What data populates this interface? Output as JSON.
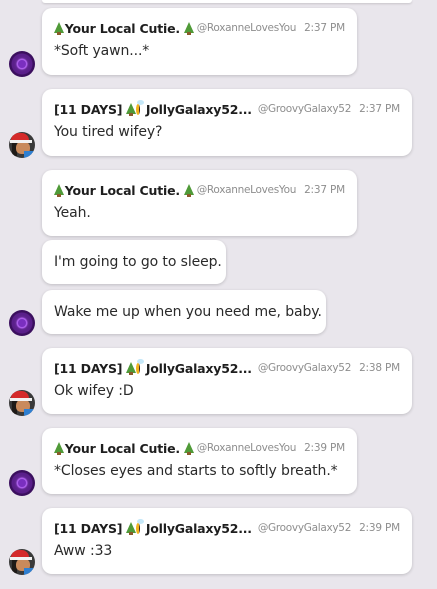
{
  "users": {
    "roxanne": {
      "name": "Your Local Cutie.",
      "handle": "@RoxanneLovesYou"
    },
    "jolly": {
      "prefix": "[11 DAYS]",
      "name": "JollyGalaxy52...",
      "handle": "@GroovyGalaxy52"
    }
  },
  "messages": [
    {
      "time": "2:37 PM",
      "text": "*Soft yawn...*"
    },
    {
      "time": "2:37 PM",
      "text": "You tired wifey?"
    },
    {
      "time": "2:37 PM",
      "text": "Yeah."
    },
    {
      "text": "I'm going to go to sleep."
    },
    {
      "text": "Wake me up when you need me, baby."
    },
    {
      "time": "2:38 PM",
      "text": "Ok wifey :D"
    },
    {
      "time": "2:39 PM",
      "text": "*Closes eyes and starts to softly breath.*"
    },
    {
      "time": "2:39 PM",
      "text": "Aww :33"
    }
  ]
}
